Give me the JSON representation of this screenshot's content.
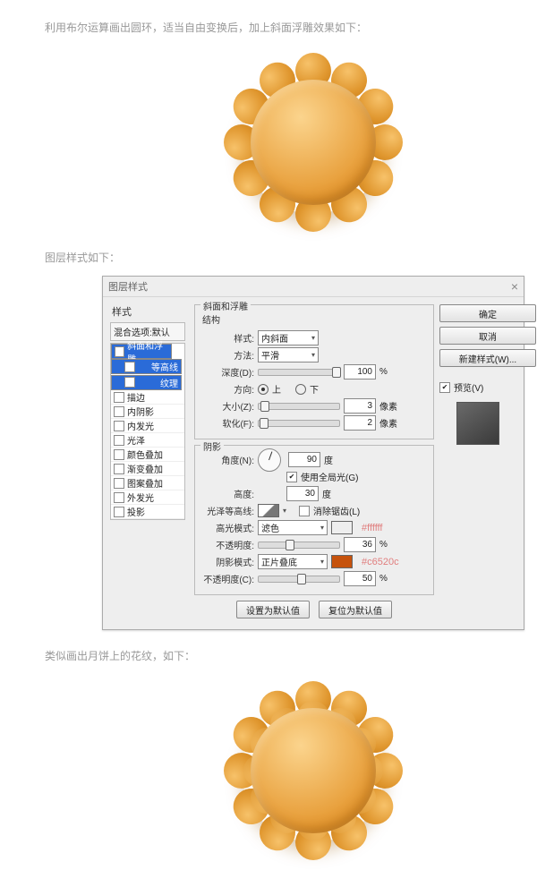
{
  "captions": {
    "top": "利用布尔运算画出圆环，适当自由变换后，加上斜面浮雕效果如下：",
    "mid": "图层样式如下：",
    "bottom": "类似画出月饼上的花纹，如下："
  },
  "dialog": {
    "title": "图层样式",
    "side": {
      "header": "样式",
      "defaults": "混合选项:默认",
      "items": [
        {
          "label": "斜面和浮雕",
          "checked": true,
          "selected": true,
          "sub": false
        },
        {
          "label": "等高线",
          "checked": false,
          "selected": true,
          "sub": true
        },
        {
          "label": "纹理",
          "checked": false,
          "selected": true,
          "sub": true
        },
        {
          "label": "描边",
          "checked": false,
          "selected": false,
          "sub": false
        },
        {
          "label": "内阴影",
          "checked": false,
          "selected": false,
          "sub": false
        },
        {
          "label": "内发光",
          "checked": false,
          "selected": false,
          "sub": false
        },
        {
          "label": "光泽",
          "checked": false,
          "selected": false,
          "sub": false
        },
        {
          "label": "颜色叠加",
          "checked": false,
          "selected": false,
          "sub": false
        },
        {
          "label": "渐变叠加",
          "checked": false,
          "selected": false,
          "sub": false
        },
        {
          "label": "图案叠加",
          "checked": false,
          "selected": false,
          "sub": false
        },
        {
          "label": "外发光",
          "checked": false,
          "selected": false,
          "sub": false
        },
        {
          "label": "投影",
          "checked": false,
          "selected": false,
          "sub": false
        }
      ]
    },
    "structure": {
      "legend": "斜面和浮雕",
      "sub": "结构",
      "style_label": "样式:",
      "style_val": "内斜面",
      "tech_label": "方法:",
      "tech_val": "平滑",
      "depth_label": "深度(D):",
      "depth_val": "100",
      "pct": "%",
      "dir_label": "方向:",
      "dir_up": "上",
      "dir_down": "下",
      "size_label": "大小(Z):",
      "size_val": "3",
      "px": "像素",
      "soft_label": "软化(F):",
      "soft_val": "2"
    },
    "shadow": {
      "legend": "阴影",
      "angle_label": "角度(N):",
      "angle_val": "90",
      "deg": "度",
      "global": "使用全局光(G)",
      "alt_label": "高度:",
      "alt_val": "30",
      "gloss_label": "光泽等高线:",
      "aa": "消除锯齿(L)",
      "hmode_label": "高光模式:",
      "hmode_val": "滤色",
      "hcol": "#ffffff",
      "hop_label": "不透明度:",
      "hop_val": "36",
      "smode_label": "阴影模式:",
      "smode_val": "正片叠底",
      "scol": "#c6520c",
      "sop_label": "不透明度(C):",
      "sop_val": "50"
    },
    "annot": {
      "white": "#ffffff",
      "orange": "#c6520c"
    },
    "buttons": {
      "default": "设置为默认值",
      "reset": "复位为默认值"
    },
    "right": {
      "ok": "确定",
      "cancel": "取消",
      "newstyle": "新建样式(W)...",
      "preview": "预览(V)"
    }
  },
  "colors": {
    "white": "#ffffff",
    "shadow": "#c6520c"
  }
}
